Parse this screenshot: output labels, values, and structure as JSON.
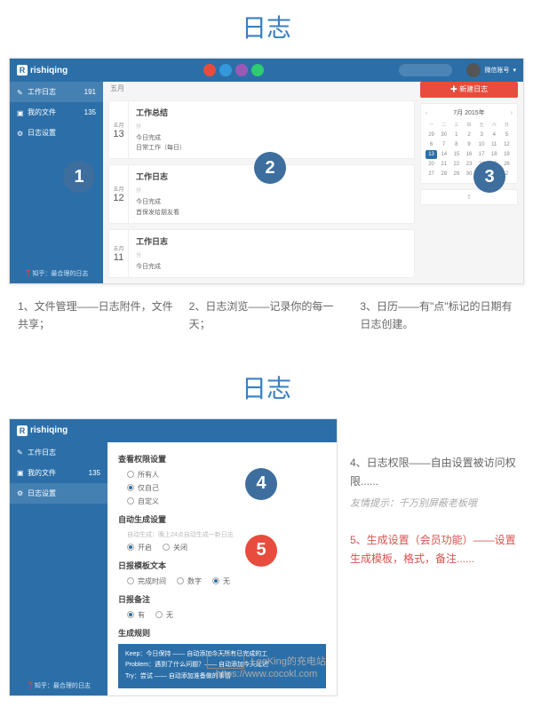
{
  "section1": {
    "title": "日志",
    "logo": "rishiqing",
    "user": "微信账号",
    "sidebar": [
      {
        "label": "工作日志",
        "count": "191"
      },
      {
        "label": "我的文件",
        "count": "135"
      },
      {
        "label": "日志设置",
        "count": ""
      }
    ],
    "sidebar_tip": "❓知乎：最合理的日志",
    "entries": [
      {
        "month": "五月",
        "day": "13",
        "title": "工作总结",
        "sub": "分",
        "body1": "今日完成",
        "body2": "日常工作（每日）"
      },
      {
        "month": "五月",
        "day": "12",
        "title": "工作日志",
        "sub": "分",
        "body1": "今日完成",
        "body2": "首保发给朋友看"
      },
      {
        "month": "五月",
        "day": "11",
        "title": "工作日志",
        "sub": "分",
        "body1": "今日完成",
        "body2": ""
      }
    ],
    "new_btn": "✚ 新建日志",
    "cal_month": "7月 2015年",
    "cal_headers": [
      "一",
      "二",
      "三",
      "四",
      "五",
      "六",
      "日"
    ],
    "cal_days": [
      "29",
      "30",
      "1",
      "2",
      "3",
      "4",
      "5",
      "6",
      "7",
      "8",
      "9",
      "10",
      "11",
      "12",
      "13",
      "14",
      "15",
      "16",
      "17",
      "18",
      "19",
      "20",
      "21",
      "22",
      "23",
      "24",
      "25",
      "26",
      "27",
      "28",
      "29",
      "30",
      "31",
      "1",
      "2"
    ],
    "captions": [
      "1、文件管理——日志附件，文件共享；",
      "2、日志浏览——记录你的每一天；",
      "3、日历——有\"点\"标记的日期有日志创建。"
    ]
  },
  "section2": {
    "title": "日志",
    "logo": "rishiqing",
    "sidebar": [
      {
        "label": "工作日志",
        "count": ""
      },
      {
        "label": "我的文件",
        "count": "135"
      },
      {
        "label": "日志设置",
        "count": ""
      }
    ],
    "sidebar_tip": "❓知乎：最合理的日志",
    "perm_title": "查看权限设置",
    "perm_options": [
      "所有人",
      "仅自己",
      "自定义"
    ],
    "auto_title": "自动生成设置",
    "auto_hint": "自动生成：晚上24点自动生成一新日志",
    "auto_options": [
      "开启",
      "关闭"
    ],
    "tmpl_title": "日报模板文本",
    "tmpl_options": [
      "完成时间",
      "数字",
      "无"
    ],
    "remark_title": "日报备注",
    "remark_options": [
      "有",
      "无"
    ],
    "gen_title": "生成规则",
    "gen_lines": [
      "Keep：今日保持 —— 自动添加今天所有已完成的工",
      "Problem：遇到了什么问题？—— 自动添加今天延迟",
      "Try：尝试 —— 自动添加准备做的事情"
    ],
    "right": [
      "4、日志权限——自由设置被访问权限......",
      "友情提示：千万别屏蔽老板哦",
      "5、生成设置（会员功能）——设置生成模板，格式，备注......"
    ]
  },
  "watermark": {
    "name": "LeoKing的充电站",
    "url": "https://www.cocokl.com"
  }
}
